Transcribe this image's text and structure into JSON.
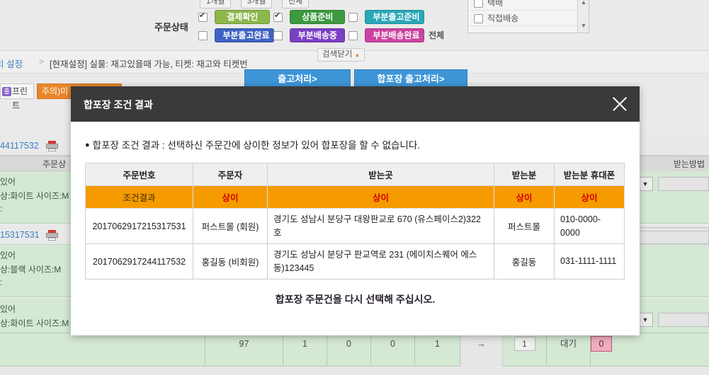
{
  "background": {
    "order_status_label": "주문상태",
    "top_mini_buttons": [
      {
        "label": "1개월"
      },
      {
        "label": "3개월"
      },
      {
        "label": "전체"
      }
    ],
    "status_options": [
      {
        "label": "결제확인",
        "checked": true,
        "color": "#8cb84a"
      },
      {
        "label": "상품준비",
        "checked": true,
        "color": "#3c9a3f"
      },
      {
        "label": "부분출고준비",
        "checked": false,
        "color": "#2aa8b8"
      },
      {
        "label": "부분출고완료",
        "checked": false,
        "color": "#3f63c4"
      },
      {
        "label": "부분배송중",
        "checked": false,
        "color": "#7b3fc4"
      },
      {
        "label": "부분배송완료",
        "checked": false,
        "color": "#cc42a0"
      }
    ],
    "all_label": "전체",
    "delivery_list": [
      {
        "label": "택배",
        "checked": false
      },
      {
        "label": "직접배송",
        "checked": false
      }
    ],
    "breadcrumb_link": "리 설정",
    "breadcrumb_arrow": ">",
    "breadcrumb_text": "[현재설정] 실물: 재고있을때 가능,  티켓: 재고와 티켓번",
    "search_close_label": "검색닫기",
    "ship_button": "출고처리>",
    "ship_pack_button": "합포장 출고처리>",
    "print_button": "프린트",
    "print_badge": "출",
    "warn_button": "주의)미",
    "right_header": "받는방법",
    "order_status_col": "주문상",
    "rows": [
      {
        "order_no": "44117532",
        "opt_line1": "있어",
        "opt_line2": "상:화이트 사이즈:M",
        "opt_line3": ":"
      },
      {
        "order_no": "15317531",
        "opt_line1": "있어",
        "opt_line2": "상:블랙 사이즈:M",
        "opt_line3": ":"
      },
      {
        "order_no": "",
        "opt_line1": "있어",
        "opt_line2": "상:화이트 사이즈:M",
        "opt_line3": ":"
      }
    ],
    "summary": {
      "values": [
        "97",
        "1",
        "0",
        "0",
        "1"
      ],
      "arrow": "→",
      "qty": "1",
      "wait_label": "대기",
      "wait_count": "0"
    }
  },
  "modal": {
    "title": "합포장 조건 결과",
    "close_icon": "close-icon",
    "message_dot": "●",
    "message": "합포장 조건 결과 : 선택하신 주문간에 상이한 정보가 있어 합포장을 할 수 없습니다.",
    "footer": "합포장 주문건을 다시 선택해 주십시오.",
    "columns": [
      "주문번호",
      "주문자",
      "받는곳",
      "받는분",
      "받는분 휴대폰"
    ],
    "result_row": {
      "label": "조건결과",
      "values": [
        "상이",
        "상이",
        "상이",
        "상이"
      ]
    },
    "rows": [
      {
        "order_no": "2017062917215317531",
        "orderer": "퍼스트몰 (회원)",
        "address": "경기도 성남시 분당구 대왕판교로 670 (유스페이스2)322호",
        "receiver": "퍼스트몰",
        "phone": "010-0000-0000"
      },
      {
        "order_no": "2017062917244117532",
        "orderer": "홍길동 (비회원)",
        "address": "경기도 성남시 분당구 판교역로 231 (에이치스퀘어 에스동)123445",
        "receiver": "홍길동",
        "phone": "031-1111-1111"
      }
    ]
  }
}
